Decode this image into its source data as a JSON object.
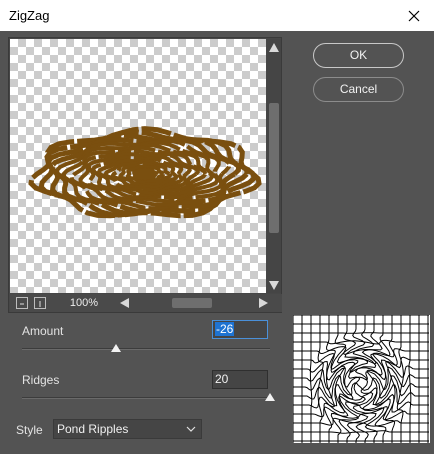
{
  "window": {
    "title": "ZigZag"
  },
  "buttons": {
    "ok": "OK",
    "cancel": "Cancel"
  },
  "preview": {
    "zoom": "100%"
  },
  "amount": {
    "label": "Amount",
    "value": "-26",
    "slider_fraction": 0.38
  },
  "ridges": {
    "label": "Ridges",
    "value": "20",
    "slider_fraction": 1.0
  },
  "style": {
    "label": "Style",
    "selected": "Pond Ripples"
  },
  "icons": {
    "close": "close-icon",
    "up": "up-arrow-icon",
    "down": "down-arrow-icon",
    "left": "left-arrow-icon",
    "right": "right-arrow-icon",
    "dropdown": "chevron-down-icon"
  },
  "colors": {
    "ripple": "#7a4f0f",
    "selection": "#1e73d2"
  }
}
